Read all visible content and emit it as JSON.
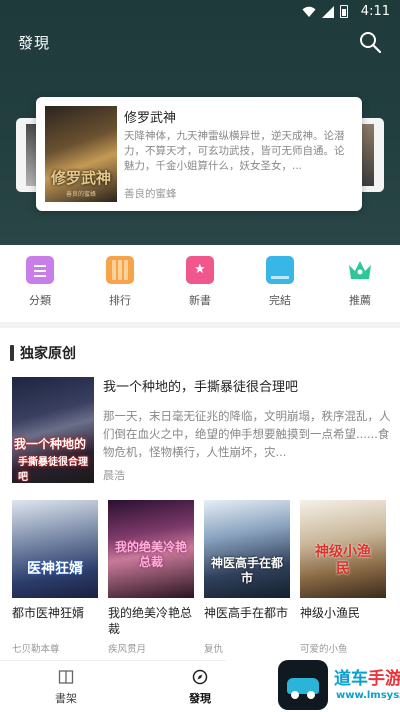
{
  "status_bar": {
    "time": "4:11"
  },
  "header": {
    "title": "發現"
  },
  "carousel": {
    "featured": {
      "title": "修罗武神",
      "cover_text": "修罗武神",
      "cover_subtext": "善良的蜜蜂",
      "description": "天降神体，九天神雷纵横异世，逆天成神。论潜力，不算天才，可玄功武技，皆可无师自通。论魅力，千金小姐算什么，妖女圣女，...",
      "author": "善良的蜜蜂"
    }
  },
  "categories": [
    {
      "label": "分類",
      "icon": "category-icon",
      "color": "#c87de8"
    },
    {
      "label": "排行",
      "icon": "ranking-icon",
      "color": "#f6a34a"
    },
    {
      "label": "新書",
      "icon": "new-book-icon",
      "color": "#f0578d"
    },
    {
      "label": "完結",
      "icon": "completed-icon",
      "color": "#38b6e8"
    },
    {
      "label": "推薦",
      "icon": "recommend-crown-icon",
      "color": "#2fc79a"
    }
  ],
  "section": {
    "title": "独家原创"
  },
  "featured_book": {
    "title": "我一个种地的，手撕暴徒很合理吧",
    "cover_line1": "我一个种地的",
    "cover_line2": "手撕暴徒很合理吧",
    "description": "那一天，末日毫无征兆的降临，文明崩塌，秩序混乱，人们倒在血火之中，绝望的伸手想要触摸到一点希望......食物危机，怪物横行，人性崩坏，灾...",
    "author": "晨浩"
  },
  "grid_books": [
    {
      "title": "都市医神狂婿",
      "author": "七贝勒本尊",
      "cover_text": "医神狂婿"
    },
    {
      "title": "我的绝美冷艳总裁",
      "author": "疾风贯月",
      "cover_text": "我的绝美冷艳总裁"
    },
    {
      "title": "神医高手在都市",
      "author": "复仇",
      "cover_text": "神医高手在都市"
    },
    {
      "title": "神级小渔民",
      "author": "可爱的小鱼",
      "cover_text": "神级小渔民"
    }
  ],
  "bottom_nav": [
    {
      "label": "書架",
      "icon": "bookshelf-icon"
    },
    {
      "label": "發現",
      "icon": "discover-icon",
      "active": true
    },
    {
      "label": "",
      "icon": "profile-icon"
    }
  ],
  "watermark": {
    "text_a": "道车",
    "text_b": "手游网",
    "url": "www.lmsysz.com"
  }
}
